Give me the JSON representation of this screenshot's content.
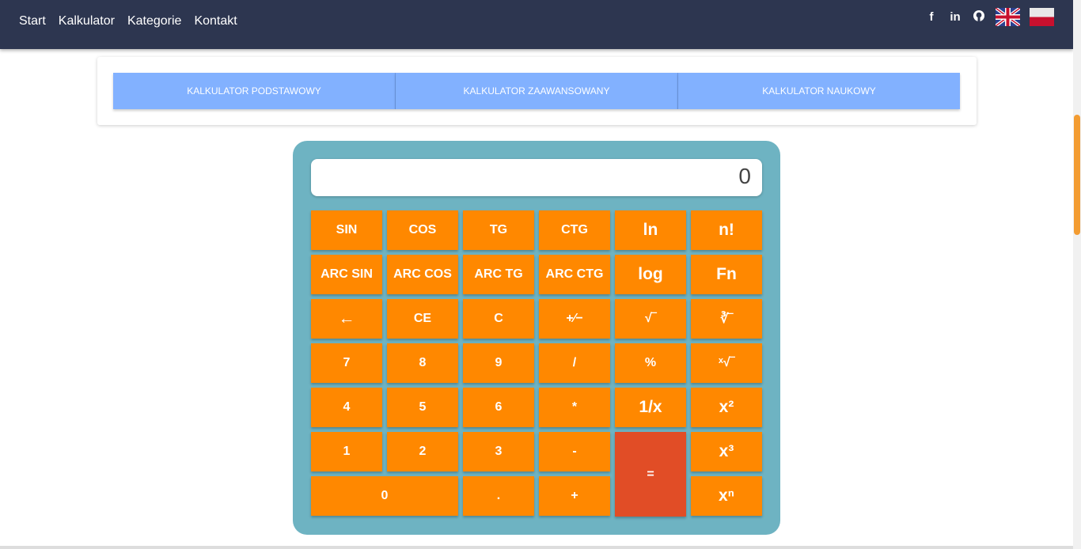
{
  "nav": {
    "links": [
      "Start",
      "Kalkulator",
      "Kategorie",
      "Kontakt"
    ],
    "social": [
      {
        "icon": "facebook-icon",
        "glyph": "f"
      },
      {
        "icon": "linkedin-icon",
        "glyph": "in"
      },
      {
        "icon": "github-icon",
        "glyph": "⬤"
      }
    ],
    "flags": [
      "uk-flag-icon",
      "poland-flag-icon"
    ]
  },
  "tabs": [
    "KALKULATOR PODSTAWOWY",
    "KALKULATOR ZAAWANSOWANY",
    "KALKULATOR NAUKOWY"
  ],
  "calculator": {
    "display": "0",
    "keys": {
      "sin": "SIN",
      "cos": "COS",
      "tg": "TG",
      "ctg": "CTG",
      "ln": "ln",
      "fact": "n!",
      "arcsin": "ARC SIN",
      "arccos": "ARC COS",
      "arctg": "ARC TG",
      "arcctg": "ARC CTG",
      "log": "log",
      "fib": "Fn",
      "back": "←",
      "ce": "CE",
      "c": "C",
      "sign": "+⁄−",
      "sqrt": "√‾",
      "cbrt": "∛‾",
      "k7": "7",
      "k8": "8",
      "k9": "9",
      "div": "/",
      "pct": "%",
      "xroot": "ˣ√‾",
      "k4": "4",
      "k5": "5",
      "k6": "6",
      "mul": "*",
      "inv": "1/x",
      "sq": "x²",
      "k1": "1",
      "k2": "2",
      "k3": "3",
      "sub": "-",
      "eq": "=",
      "cube": "x³",
      "k0": "0",
      "dot": ".",
      "add": "+",
      "pow": "xⁿ"
    }
  },
  "colors": {
    "navbar": "#2d3650",
    "tab": "#82b1ff",
    "calc_body": "#6eb3c2",
    "key": "#ff8800",
    "equals_key": "#e14d26",
    "scroll_thumb": "#f39c32"
  }
}
